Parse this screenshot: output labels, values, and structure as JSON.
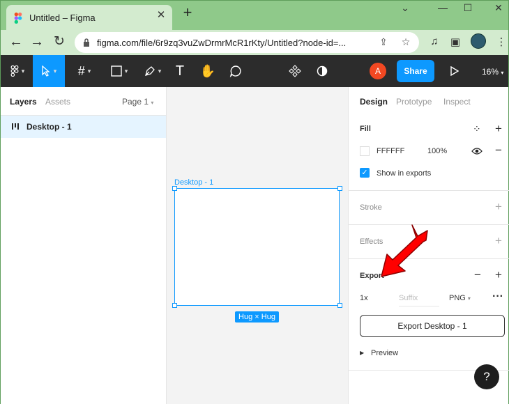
{
  "browser": {
    "tab_title": "Untitled – Figma",
    "url": "figma.com/file/6r9zq3vuZwDrmrMcR1rKty/Untitled?node-id=..."
  },
  "figma_toolbar": {
    "share_label": "Share",
    "zoom": "16%",
    "user_initial": "A"
  },
  "layers_panel": {
    "tabs": [
      "Layers",
      "Assets"
    ],
    "page": "Page 1",
    "layers": [
      "Desktop - 1"
    ]
  },
  "canvas": {
    "frame_label": "Desktop - 1",
    "hug_badge": "Hug × Hug"
  },
  "design_panel": {
    "tabs": [
      "Design",
      "Prototype",
      "Inspect"
    ],
    "fill": {
      "title": "Fill",
      "color": "FFFFFF",
      "opacity": "100%",
      "show_in_exports": "Show in exports"
    },
    "stroke_title": "Stroke",
    "effects_title": "Effects",
    "export": {
      "title": "Export",
      "scale": "1x",
      "suffix_placeholder": "Suffix",
      "format": "PNG",
      "button": "Export Desktop - 1",
      "preview": "Preview"
    },
    "help": "?"
  },
  "colors": {
    "accent": "#0d99ff",
    "toolbar_bg": "#2c2c2c",
    "chrome_tab_bg": "#8fc98a",
    "annotation": "#ff0000"
  }
}
